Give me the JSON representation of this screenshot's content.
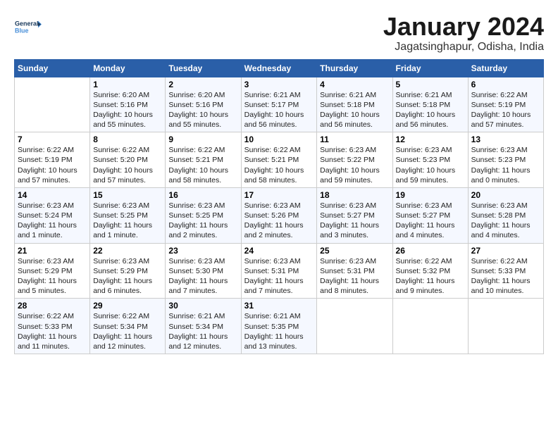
{
  "header": {
    "logo_general": "General",
    "logo_blue": "Blue",
    "title": "January 2024",
    "subtitle": "Jagatsinghapur, Odisha, India"
  },
  "weekdays": [
    "Sunday",
    "Monday",
    "Tuesday",
    "Wednesday",
    "Thursday",
    "Friday",
    "Saturday"
  ],
  "weeks": [
    [
      {
        "day": "",
        "info": ""
      },
      {
        "day": "1",
        "info": "Sunrise: 6:20 AM\nSunset: 5:16 PM\nDaylight: 10 hours\nand 55 minutes."
      },
      {
        "day": "2",
        "info": "Sunrise: 6:20 AM\nSunset: 5:16 PM\nDaylight: 10 hours\nand 55 minutes."
      },
      {
        "day": "3",
        "info": "Sunrise: 6:21 AM\nSunset: 5:17 PM\nDaylight: 10 hours\nand 56 minutes."
      },
      {
        "day": "4",
        "info": "Sunrise: 6:21 AM\nSunset: 5:18 PM\nDaylight: 10 hours\nand 56 minutes."
      },
      {
        "day": "5",
        "info": "Sunrise: 6:21 AM\nSunset: 5:18 PM\nDaylight: 10 hours\nand 56 minutes."
      },
      {
        "day": "6",
        "info": "Sunrise: 6:22 AM\nSunset: 5:19 PM\nDaylight: 10 hours\nand 57 minutes."
      }
    ],
    [
      {
        "day": "7",
        "info": "Sunrise: 6:22 AM\nSunset: 5:19 PM\nDaylight: 10 hours\nand 57 minutes."
      },
      {
        "day": "8",
        "info": "Sunrise: 6:22 AM\nSunset: 5:20 PM\nDaylight: 10 hours\nand 57 minutes."
      },
      {
        "day": "9",
        "info": "Sunrise: 6:22 AM\nSunset: 5:21 PM\nDaylight: 10 hours\nand 58 minutes."
      },
      {
        "day": "10",
        "info": "Sunrise: 6:22 AM\nSunset: 5:21 PM\nDaylight: 10 hours\nand 58 minutes."
      },
      {
        "day": "11",
        "info": "Sunrise: 6:23 AM\nSunset: 5:22 PM\nDaylight: 10 hours\nand 59 minutes."
      },
      {
        "day": "12",
        "info": "Sunrise: 6:23 AM\nSunset: 5:23 PM\nDaylight: 10 hours\nand 59 minutes."
      },
      {
        "day": "13",
        "info": "Sunrise: 6:23 AM\nSunset: 5:23 PM\nDaylight: 11 hours\nand 0 minutes."
      }
    ],
    [
      {
        "day": "14",
        "info": "Sunrise: 6:23 AM\nSunset: 5:24 PM\nDaylight: 11 hours\nand 1 minute."
      },
      {
        "day": "15",
        "info": "Sunrise: 6:23 AM\nSunset: 5:25 PM\nDaylight: 11 hours\nand 1 minute."
      },
      {
        "day": "16",
        "info": "Sunrise: 6:23 AM\nSunset: 5:25 PM\nDaylight: 11 hours\nand 2 minutes."
      },
      {
        "day": "17",
        "info": "Sunrise: 6:23 AM\nSunset: 5:26 PM\nDaylight: 11 hours\nand 2 minutes."
      },
      {
        "day": "18",
        "info": "Sunrise: 6:23 AM\nSunset: 5:27 PM\nDaylight: 11 hours\nand 3 minutes."
      },
      {
        "day": "19",
        "info": "Sunrise: 6:23 AM\nSunset: 5:27 PM\nDaylight: 11 hours\nand 4 minutes."
      },
      {
        "day": "20",
        "info": "Sunrise: 6:23 AM\nSunset: 5:28 PM\nDaylight: 11 hours\nand 4 minutes."
      }
    ],
    [
      {
        "day": "21",
        "info": "Sunrise: 6:23 AM\nSunset: 5:29 PM\nDaylight: 11 hours\nand 5 minutes."
      },
      {
        "day": "22",
        "info": "Sunrise: 6:23 AM\nSunset: 5:29 PM\nDaylight: 11 hours\nand 6 minutes."
      },
      {
        "day": "23",
        "info": "Sunrise: 6:23 AM\nSunset: 5:30 PM\nDaylight: 11 hours\nand 7 minutes."
      },
      {
        "day": "24",
        "info": "Sunrise: 6:23 AM\nSunset: 5:31 PM\nDaylight: 11 hours\nand 7 minutes."
      },
      {
        "day": "25",
        "info": "Sunrise: 6:23 AM\nSunset: 5:31 PM\nDaylight: 11 hours\nand 8 minutes."
      },
      {
        "day": "26",
        "info": "Sunrise: 6:22 AM\nSunset: 5:32 PM\nDaylight: 11 hours\nand 9 minutes."
      },
      {
        "day": "27",
        "info": "Sunrise: 6:22 AM\nSunset: 5:33 PM\nDaylight: 11 hours\nand 10 minutes."
      }
    ],
    [
      {
        "day": "28",
        "info": "Sunrise: 6:22 AM\nSunset: 5:33 PM\nDaylight: 11 hours\nand 11 minutes."
      },
      {
        "day": "29",
        "info": "Sunrise: 6:22 AM\nSunset: 5:34 PM\nDaylight: 11 hours\nand 12 minutes."
      },
      {
        "day": "30",
        "info": "Sunrise: 6:21 AM\nSunset: 5:34 PM\nDaylight: 11 hours\nand 12 minutes."
      },
      {
        "day": "31",
        "info": "Sunrise: 6:21 AM\nSunset: 5:35 PM\nDaylight: 11 hours\nand 13 minutes."
      },
      {
        "day": "",
        "info": ""
      },
      {
        "day": "",
        "info": ""
      },
      {
        "day": "",
        "info": ""
      }
    ]
  ]
}
